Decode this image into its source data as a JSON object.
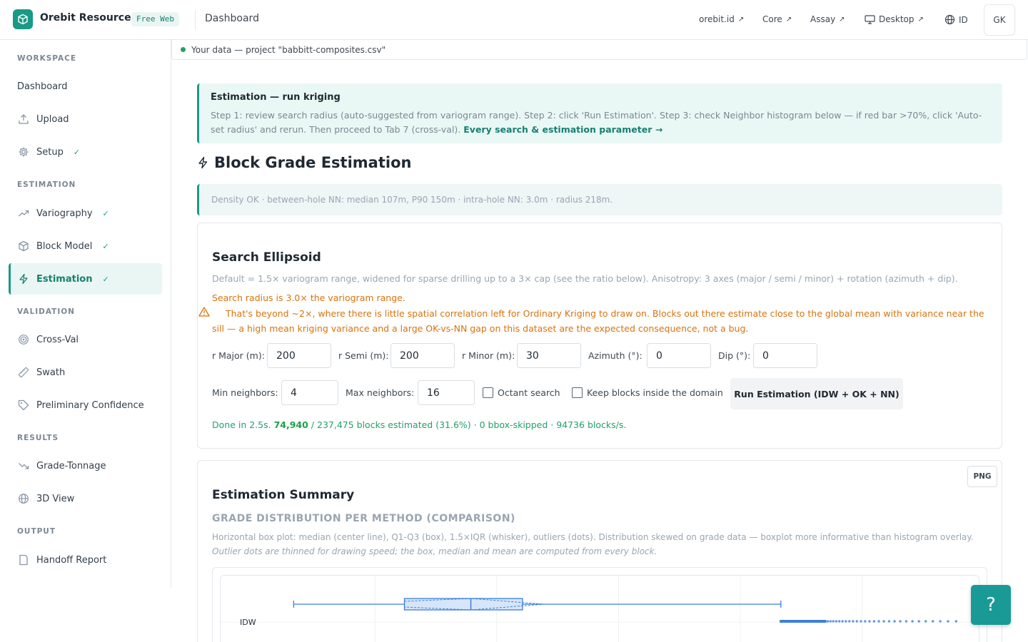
{
  "header": {
    "brand": "Orebit Resource",
    "badge": "Free Web",
    "title": "Dashboard",
    "links": [
      "orebit.id",
      "Core",
      "Assay",
      "Desktop"
    ],
    "language": "ID",
    "user_initials": "GK"
  },
  "sidebar": {
    "sections": [
      "WORKSPACE",
      "ESTIMATION",
      "VALIDATION",
      "RESULTS",
      "OUTPUT"
    ],
    "items": [
      {
        "label": "Dashboard",
        "icon": "none"
      },
      {
        "label": "Upload",
        "icon": "upload-icon"
      },
      {
        "label": "Setup",
        "icon": "gear-icon",
        "done": "✓"
      },
      {
        "label": "Variography",
        "icon": "trend-icon",
        "done": "✓"
      },
      {
        "label": "Block Model",
        "icon": "cube-icon",
        "done": "✓"
      },
      {
        "label": "Estimation",
        "icon": "bolt-icon",
        "done": "✓"
      },
      {
        "label": "Cross-Val",
        "icon": "target-icon"
      },
      {
        "label": "Swath",
        "icon": "ruler-icon"
      },
      {
        "label": "Preliminary Confidence",
        "icon": "tag-icon"
      },
      {
        "label": "Grade-Tonnage",
        "icon": "trend-down-icon"
      },
      {
        "label": "3D View",
        "icon": "globe-icon"
      },
      {
        "label": "Handoff Report",
        "icon": "document-icon"
      }
    ]
  },
  "status": {
    "text": "Your data — project \"babbitt-composites.csv\""
  },
  "info": {
    "title": "Estimation — run kriging",
    "text": "Step 1: review search radius (auto-suggested from variogram range). Step 2: click 'Run Estimation'. Step 3: check Neighbor histogram below — if red bar >70%, click 'Auto-set radius' and rerun. Then proceed to Tab 7 (cross-val). ",
    "link": "Every search & estimation parameter →"
  },
  "page_title": "Block Grade Estimation",
  "density_note": "Density OK · between-hole NN: median 107m, P90 150m · intra-hole NN: 3.0m · radius 218m.",
  "search": {
    "title": "Search Ellipsoid",
    "default_note": "Default = 1.5× variogram range, widened for sparse drilling up to a 3× cap (see the ratio below). Anisotropy: 3 axes (major / semi / minor) + rotation (azimuth + dip).",
    "warning_1": "Search radius is 3.0× the variogram range.",
    "warning_2": "That's beyond ~2×, where there is little spatial correlation left for Ordinary Kriging to draw on. Blocks out there estimate close to the global mean with variance near the sill — a high mean kriging variance and a large OK-vs-NN gap on this dataset are the expected consequence, not a bug.",
    "fields": {
      "r_major_label": "r Major (m):",
      "r_major": "200",
      "r_semi_label": "r Semi (m):",
      "r_semi": "200",
      "r_minor_label": "r Minor (m):",
      "r_minor": "30",
      "azimuth_label": "Azimuth (°):",
      "azimuth": "0",
      "dip_label": "Dip (°):",
      "dip": "0",
      "min_label": "Min neighbors:",
      "min": "4",
      "max_label": "Max neighbors:",
      "max": "16"
    },
    "octant_label": "Octant search",
    "keep_label": "Keep blocks inside the domain",
    "run_label": "Run Estimation (IDW + OK + NN)",
    "done_prefix": "Done in 2.5s. ",
    "done_count": "74,940",
    "done_suffix": " / 237,475 blocks estimated (31.6%) · 0 bbox-skipped · 94736 blocks/s."
  },
  "summary": {
    "title": "Estimation Summary",
    "png_label": "PNG",
    "subtitle": "GRADE DISTRIBUTION PER METHOD (COMPARISON)",
    "desc": "Horizontal box plot: median (center line), Q1-Q3 (box), 1.5×IQR (whisker), outliers (dots). Distribution skewed on grade data — boxplot more informative than histogram overlay. ",
    "desc_italic": "Outlier dots are thinned for drawing speed; the box, median and mean are computed from every block."
  },
  "chart_data": {
    "type": "boxplot",
    "series": [
      {
        "name": "IDW",
        "whisker_low": 0.07,
        "q1": 0.22,
        "median": 0.31,
        "q3": 0.38,
        "whisker_high": 0.73,
        "mean": 0.34
      }
    ],
    "color": "#3b7fdc",
    "grid": true
  },
  "help": {
    "label": "?"
  },
  "colors": {
    "accent": "#1a9a86",
    "warning": "#d9730d",
    "success": "#22a06b",
    "chart": "#3b7fdc"
  }
}
